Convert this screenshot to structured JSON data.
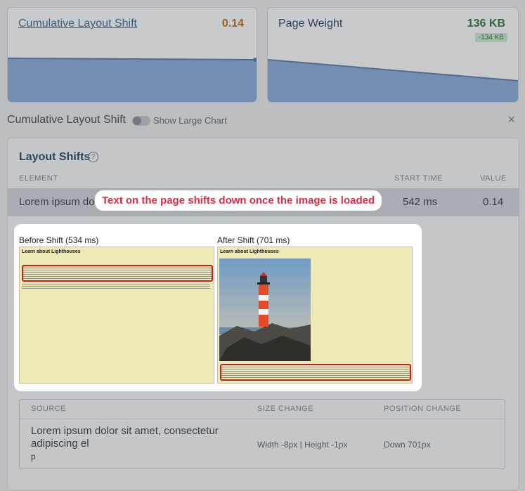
{
  "cards": {
    "cls": {
      "title": "Cumulative Layout Shift",
      "value": "0.14",
      "value_color": "#b5620f"
    },
    "weight": {
      "title": "Page Weight",
      "value": "136 KB",
      "badge": "-134 KB",
      "value_color": "#1f6b3a"
    }
  },
  "section": {
    "title": "Cumulative Layout Shift",
    "toggle_label": "Show Large Chart",
    "close": "×"
  },
  "panel": {
    "title": "Layout Shifts",
    "help": "?",
    "columns": {
      "element": "ELEMENT",
      "start": "START TIME",
      "value": "VALUE"
    },
    "row": {
      "element": "Lorem ipsum do",
      "start": "542 ms",
      "value": "0.14"
    }
  },
  "callout": "Text on the page shifts down once the image is loaded",
  "shots": {
    "before": {
      "label": "Before Shift (534 ms)",
      "heading": "Learn about Lighthouses"
    },
    "after": {
      "label": "After Shift (701 ms)",
      "heading": "Learn about Lighthouses"
    }
  },
  "sources": {
    "columns": {
      "source": "SOURCE",
      "size": "SIZE CHANGE",
      "position": "POSITION CHANGE"
    },
    "row": {
      "source_line1": "Lorem ipsum dolor sit amet, consectetur",
      "source_line2": "adipiscing el",
      "source_line3": "p",
      "size": "Width -8px | Height -1px",
      "position": "Down 701px"
    }
  }
}
